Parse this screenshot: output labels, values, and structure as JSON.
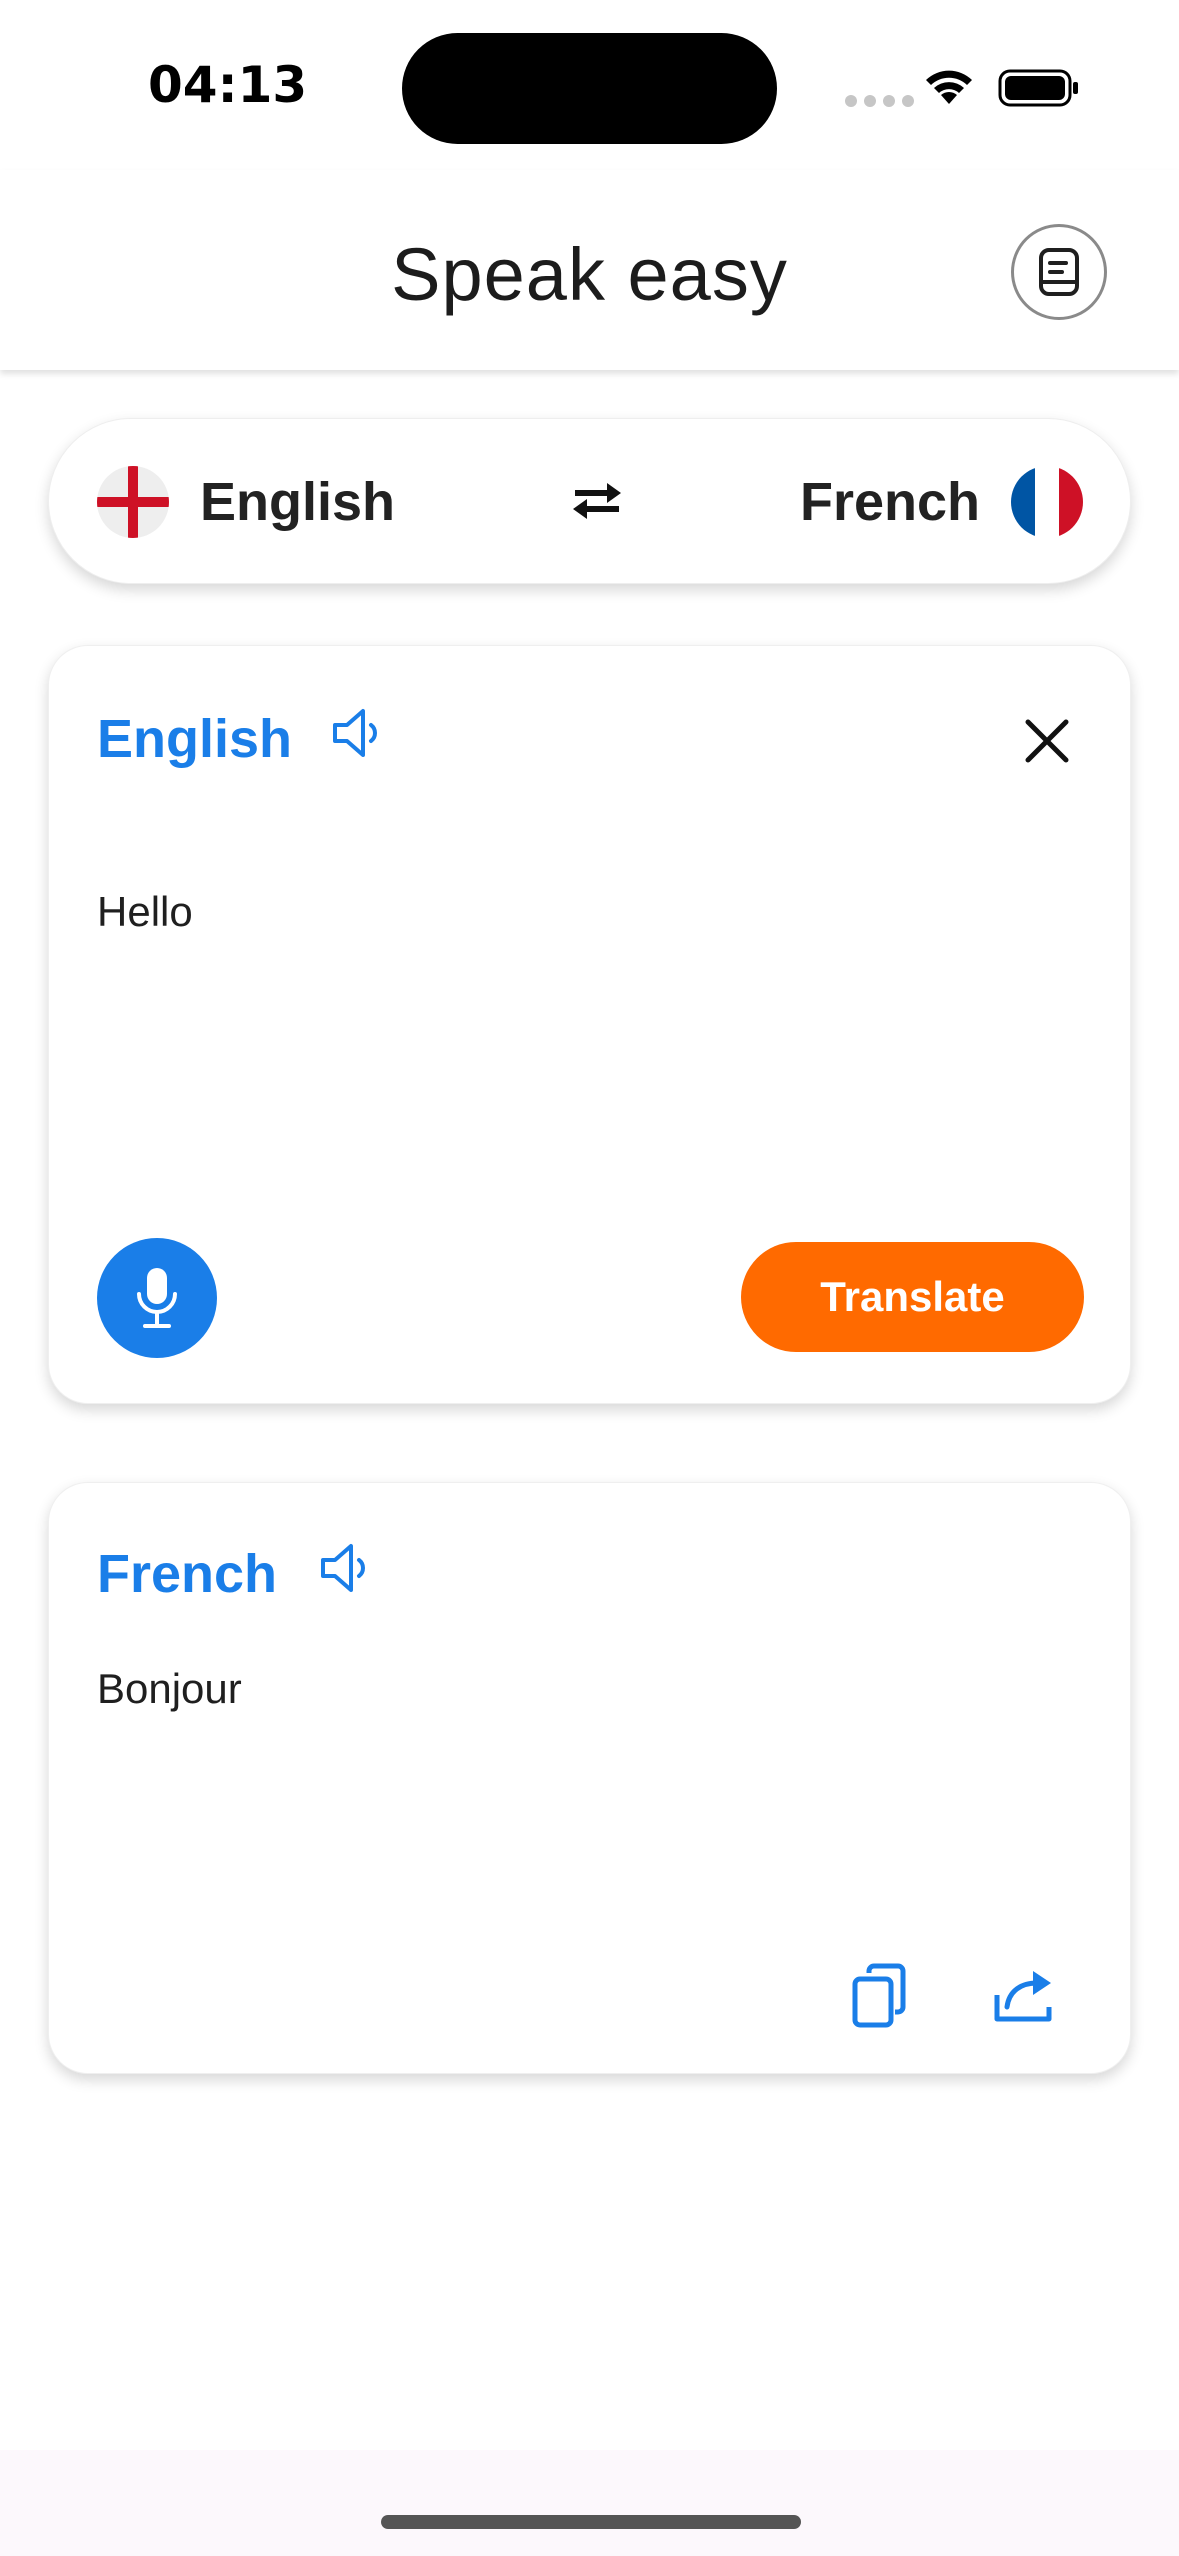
{
  "status_bar": {
    "time": "04:13",
    "wifi_icon": "wifi-icon",
    "battery_icon": "battery-icon"
  },
  "app_bar": {
    "title": "Speak easy",
    "history_icon": "history-icon"
  },
  "language_selector": {
    "source_language": "English",
    "source_flag": "england-flag",
    "target_language": "French",
    "target_flag": "france-flag",
    "swap_icon": "swap-icon"
  },
  "input_card": {
    "language": "English",
    "text": "Hello",
    "translate_label": "Translate"
  },
  "output_card": {
    "language": "French",
    "text": "Bonjour"
  },
  "colors": {
    "accent_blue": "#1a7ee8",
    "translate_orange": "#ff6a00",
    "flag_red": "#ce1126",
    "flag_blue": "#0055a4"
  }
}
